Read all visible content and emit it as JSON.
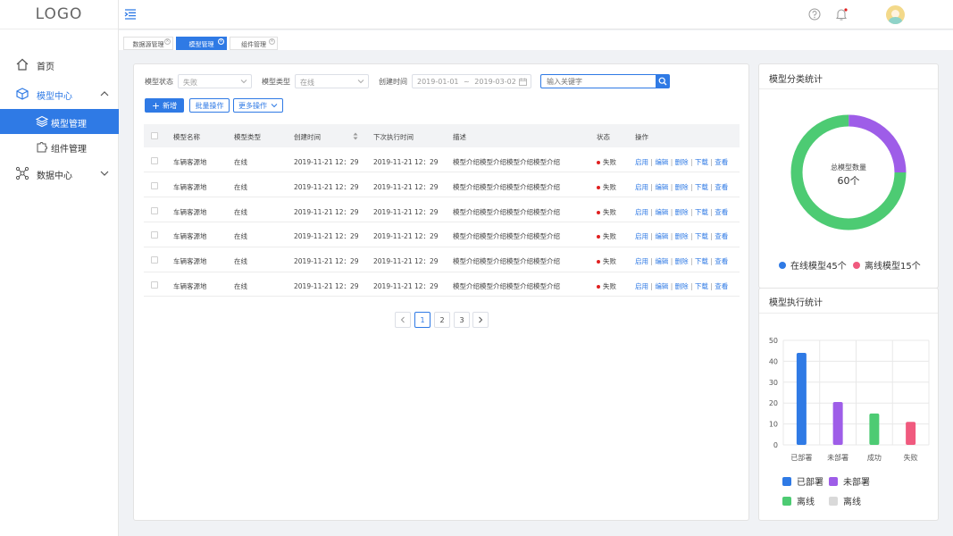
{
  "logo": "LOGO",
  "sidebar": {
    "items": [
      {
        "label": "首页"
      },
      {
        "label": "模型中心"
      },
      {
        "label": "数据中心"
      }
    ],
    "subitems": [
      {
        "label": "模型管理"
      },
      {
        "label": "组件管理"
      }
    ]
  },
  "tabs": [
    {
      "label": "数据源管理"
    },
    {
      "label": "模型管理"
    },
    {
      "label": "组件管理"
    }
  ],
  "filters": {
    "status_label": "模型状态",
    "status_value": "失败",
    "type_label": "模型类型",
    "type_value": "在线",
    "time_label": "创建时间",
    "date_start": "2019-01-01",
    "date_sep": "~",
    "date_end": "2019-03-02",
    "search_placeholder": "输入关键字"
  },
  "toolbar": {
    "add_label": "新增",
    "batch_label": "批量操作",
    "more_label": "更多操作"
  },
  "table": {
    "headers": [
      "模型名称",
      "模型类型",
      "创建时间",
      "下次执行时间",
      "描述",
      "状态",
      "操作"
    ],
    "rows": [
      {
        "name": "车辆客源地",
        "type": "在线",
        "created": "2019-11-21  12：29",
        "next": "2019-11-21  12：29",
        "desc": "模型介绍模型介绍模型介绍模型介绍",
        "status": "失败"
      },
      {
        "name": "车辆客源地",
        "type": "在线",
        "created": "2019-11-21  12：29",
        "next": "2019-11-21  12：29",
        "desc": "模型介绍模型介绍模型介绍模型介绍",
        "status": "失败"
      },
      {
        "name": "车辆客源地",
        "type": "在线",
        "created": "2019-11-21  12：29",
        "next": "2019-11-21  12：29",
        "desc": "模型介绍模型介绍模型介绍模型介绍",
        "status": "失败"
      },
      {
        "name": "车辆客源地",
        "type": "在线",
        "created": "2019-11-21  12：29",
        "next": "2019-11-21  12：29",
        "desc": "模型介绍模型介绍模型介绍模型介绍",
        "status": "失败"
      },
      {
        "name": "车辆客源地",
        "type": "在线",
        "created": "2019-11-21  12：29",
        "next": "2019-11-21  12：29",
        "desc": "模型介绍模型介绍模型介绍模型介绍",
        "status": "失败"
      },
      {
        "name": "车辆客源地",
        "type": "在线",
        "created": "2019-11-21  12：29",
        "next": "2019-11-21  12：29",
        "desc": "模型介绍模型介绍模型介绍模型介绍",
        "status": "失败"
      }
    ],
    "actions": [
      "启用",
      "编辑",
      "删除",
      "下载",
      "查看"
    ],
    "action_sep": "|"
  },
  "pagination": {
    "pages": [
      "1",
      "2",
      "3"
    ],
    "current": "1"
  },
  "donut": {
    "title": "模型分类统计",
    "center_label": "总模型数量",
    "center_value": "60个",
    "segments": [
      {
        "label": "在线模型45个",
        "value": 45,
        "color": "#4dcb73"
      },
      {
        "label": "离线模型15个",
        "value": 15,
        "color": "#9e5de8"
      }
    ],
    "legend_colors": [
      "#2f7ae5",
      "#f05a7e"
    ]
  },
  "bar": {
    "title": "模型执行统计",
    "legend": [
      {
        "label": "已部署",
        "color": "#2f7ae5"
      },
      {
        "label": "未部署",
        "color": "#9e5de8"
      },
      {
        "label": "离线",
        "color": "#4dcb73"
      },
      {
        "label": "离线",
        "color": "#d9d9d9"
      }
    ]
  },
  "chart_data": {
    "type": "bar",
    "categories": [
      "已部署",
      "未部署",
      "成功",
      "失败"
    ],
    "values": [
      44,
      20.5,
      15,
      11
    ],
    "colors": [
      "#2f7ae5",
      "#9e5de8",
      "#4dcb73",
      "#f05a7e"
    ],
    "yticks": [
      "0",
      "10",
      "20",
      "30",
      "40",
      "50"
    ],
    "ylim": [
      0,
      50
    ],
    "grid": true
  }
}
